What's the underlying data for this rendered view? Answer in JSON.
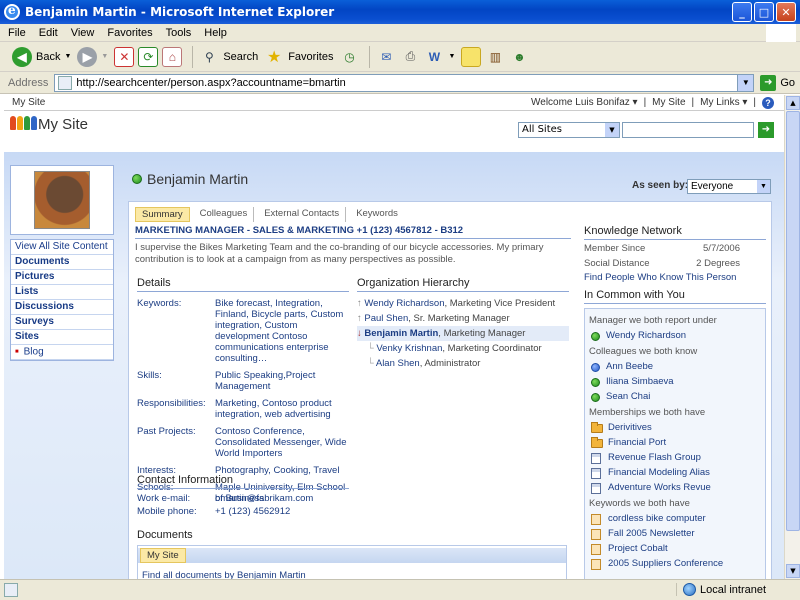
{
  "window": {
    "title": "Benjamin Martin - Microsoft Internet Explorer",
    "buttons": [
      "_",
      "□",
      "✕"
    ]
  },
  "menu": [
    "File",
    "Edit",
    "View",
    "Favorites",
    "Tools",
    "Help"
  ],
  "toolbar": {
    "back_label": "Back",
    "search_label": "Search",
    "favorites_label": "Favorites"
  },
  "address": {
    "label": "Address",
    "url": "http://searchcenter/person.aspx?accountname=bmartin",
    "go_label": "Go"
  },
  "topbar": {
    "site": "My Site",
    "welcome": "Welcome Luis Bonifaz ▾",
    "my_site": "My Site",
    "my_links": "My Links ▾"
  },
  "brand": {
    "title": "My Site",
    "scope": "All Sites",
    "logo_colors": [
      "#e24b1f",
      "#f2a413",
      "#2e9a3b",
      "#2f66c6"
    ]
  },
  "nav": {
    "view_all": "View All Site Content",
    "items": [
      "Documents",
      "Pictures",
      "Lists",
      "Discussions",
      "Surveys",
      "Sites"
    ],
    "sub_item": "Blog"
  },
  "person": {
    "name": "Benjamin Martin",
    "seen_by_label": "As seen by:",
    "seen_by_value": "Everyone"
  },
  "tabs": [
    "Summary",
    "Colleagues",
    "External Contacts",
    "Keywords"
  ],
  "profile": {
    "tagline": "MARKETING MANAGER - SALES & MARKETING +1 (123) 4567812 - B312",
    "about": "I supervise the Bikes Marketing Team and the co-branding of our bicycle accessories. My primary contribution is to look at a campaign from as many perspectives as possible."
  },
  "details": {
    "heading": "Details",
    "rows": [
      {
        "k": "Keywords:",
        "v": "Bike forecast, Integration, Finland, Bicycle parts, Custom integration, Custom development Contoso communications enterprise consulting…"
      },
      {
        "k": "Skills:",
        "v": "Public Speaking,Project Management"
      },
      {
        "k": "Responsibilities:",
        "v": "Marketing, Contoso product integration, web advertising"
      },
      {
        "k": "Past Projects:",
        "v": "Contoso Conference, Consolidated Messenger, Wide World Importers"
      },
      {
        "k": "Interests:",
        "v": "Photography, Cooking, Travel"
      },
      {
        "k": "Schools:",
        "v": "Maple Uniniversity, Elm School of Business"
      }
    ]
  },
  "org": {
    "heading": "Organization Hierarchy",
    "rows": [
      {
        "name": "Wendy Richardson",
        "role": ", Marketing Vice President"
      },
      {
        "name": "Paul Shen",
        "role": ", Sr. Marketing Manager"
      },
      {
        "name": "Benjamin Martin",
        "role": ", Marketing Manager"
      },
      {
        "name": "Venky Krishnan",
        "role": ", Marketing Coordinator"
      },
      {
        "name": "Alan Shen",
        "role": ", Administrator"
      }
    ]
  },
  "contact": {
    "heading": "Contact Information",
    "email_label": "Work e-mail:",
    "email": "bmartin@fabrikam.com",
    "phone_label": "Mobile phone:",
    "phone": "+1 (123) 4562912"
  },
  "documents": {
    "heading": "Documents",
    "tab": "My Site",
    "link": "Find all documents by Benjamin Martin"
  },
  "knowledge": {
    "heading": "Knowledge Network",
    "member_since_label": "Member Since",
    "member_since": "5/7/2006",
    "distance_label": "Social Distance",
    "distance": "2 Degrees",
    "link": "Find People Who Know This Person"
  },
  "common": {
    "heading": "In Common with You",
    "manager_label": "Manager we both report under",
    "manager": "Wendy Richardson",
    "colleagues_label": "Colleagues we both know",
    "colleagues": [
      "Ann Beebe",
      "Iliana Simbaeva",
      "Sean Chai"
    ],
    "memberships_label": "Memberships we both have",
    "memberships": [
      "Derivitives",
      "Financial Port",
      "Revenue Flash Group",
      "Financial Modeling Alias",
      "Adventure Works Revue"
    ],
    "keywords_label": "Keywords we both have",
    "keywords": [
      "cordless bike computer",
      "Fall 2005 Newsletter",
      "Project Cobalt",
      "2005 Suppliers Conference"
    ]
  },
  "status": {
    "zone": "Local intranet"
  }
}
